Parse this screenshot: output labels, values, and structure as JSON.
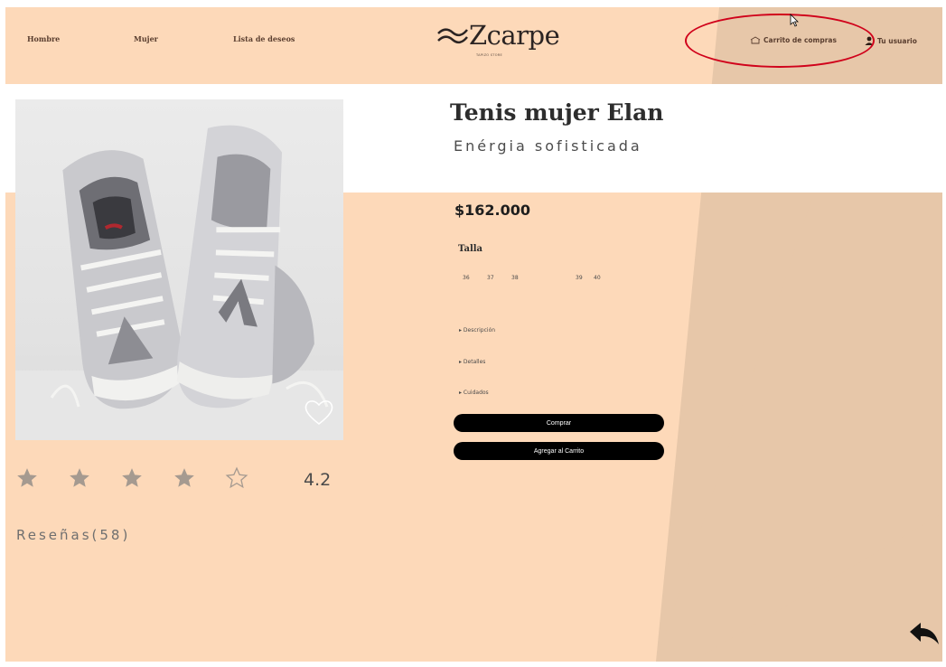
{
  "header": {
    "nav": [
      "Hombre",
      "Mujer",
      "Lista de deseos"
    ],
    "logo_text": "Zcarpe",
    "logo_sub": "TAPIZO STORE",
    "cart_label": "Carrito de compras",
    "user_label": "Tu usuario"
  },
  "product": {
    "title": "Tenis mujer Elan",
    "tagline": "Enérgia sofisticada",
    "price": "$162.000",
    "size_label": "Talla",
    "sizes": [
      "36",
      "37",
      "38",
      "39",
      "40"
    ],
    "accordion": [
      "Descripción",
      "Detalles",
      "Cuidados"
    ],
    "buy_label": "Comprar",
    "add_to_cart_label": "Agregar al Carrito"
  },
  "rating": {
    "value": "4.2",
    "filled_stars": 4,
    "total_stars": 5,
    "reviews_label": "Reseñas(58)"
  },
  "colors": {
    "background": "#fdd9b9",
    "accent_stripe": "#e7c7a9",
    "annotation": "#d0021b",
    "button": "#000000"
  },
  "icons": [
    "cart-icon",
    "user-icon",
    "heart-icon",
    "star-icon",
    "back-arrow-icon",
    "cursor-icon"
  ]
}
